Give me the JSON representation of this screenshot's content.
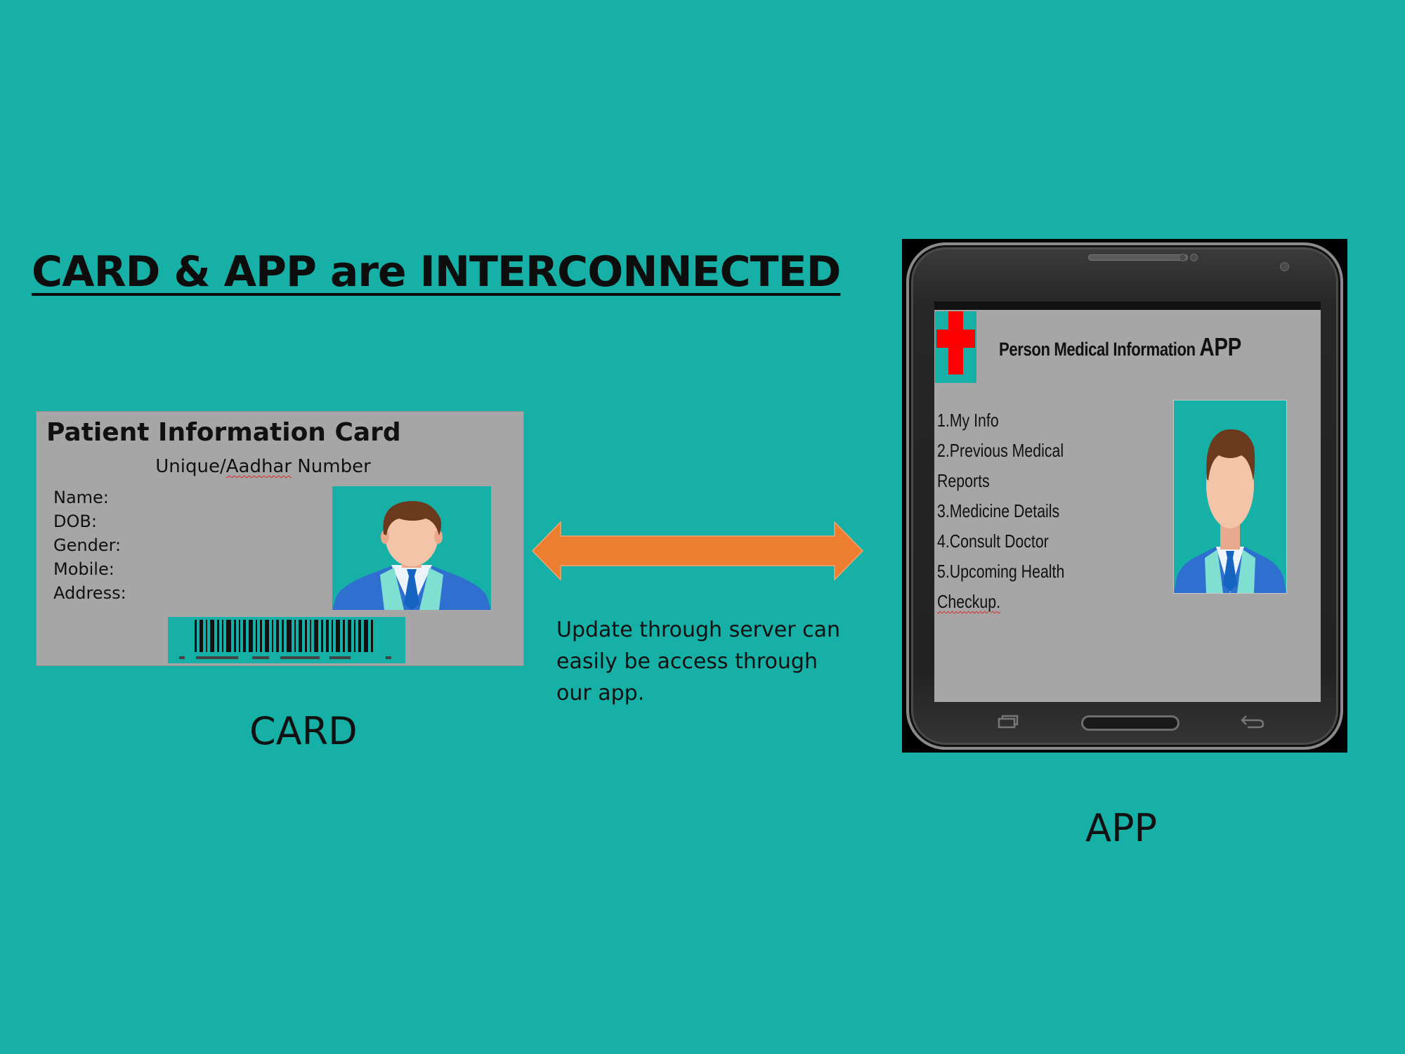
{
  "title": "CARD & APP are INTERCONNECTED",
  "card": {
    "title": "Patient Information Card",
    "subtitle_prefix": "Unique/",
    "subtitle_underlined": "Aadhar",
    "subtitle_suffix": " Number",
    "fields": [
      "Name:",
      "DOB:",
      "Gender:",
      "Mobile:",
      "Address:"
    ],
    "photo_icon": "person-avatar-icon",
    "barcode_icon": "barcode-icon"
  },
  "caption": "Update through server can easily be access through our app.",
  "labels": {
    "card": "CARD",
    "app": "APP"
  },
  "app": {
    "title_main": "Person Medical Information ",
    "title_big": "APP",
    "logo_icon": "red-cross-icon",
    "photo_icon": "person-avatar-icon",
    "menu": {
      "item1": "1.My Info",
      "item2a": "2.Previous Medical",
      "item2b": "Reports",
      "item3": "3.Medicine Details",
      "item4": "4.Consult Doctor",
      "item5a": "5.Upcoming Health",
      "item5b": "Checkup."
    }
  },
  "colors": {
    "background": "#17b0a7",
    "card_background": "#a6a6a6",
    "arrow": "#ed7d31",
    "cross": "#ff0000"
  }
}
